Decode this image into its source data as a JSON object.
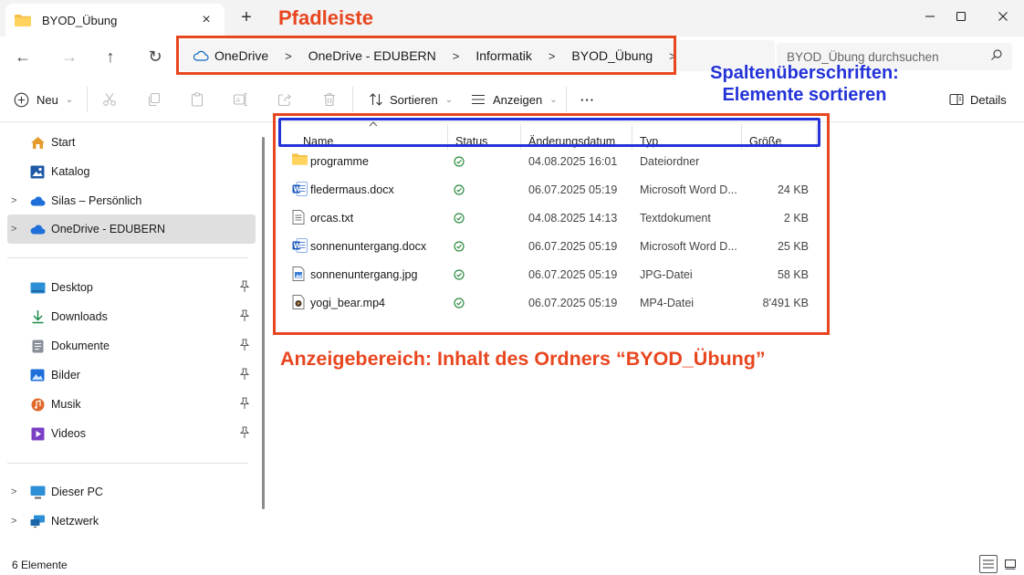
{
  "window": {
    "tab_title": "BYOD_Übung",
    "close_tab": "×",
    "new_tab": "+",
    "minimize": "—",
    "maximize": "☐",
    "close": "✕"
  },
  "nav": {
    "back": "←",
    "forward": "→",
    "up": "↑",
    "refresh": "↻"
  },
  "breadcrumb": {
    "items": [
      "OneDrive",
      "OneDrive - EDUBERN",
      "Informatik",
      "BYOD_Übung"
    ],
    "separator": ">",
    "trailing": ">"
  },
  "search": {
    "placeholder": "BYOD_Übung durchsuchen"
  },
  "toolbar": {
    "new_label": "Neu",
    "sort_label": "Sortieren",
    "view_label": "Anzeigen",
    "more_label": "···",
    "details_label": "Details"
  },
  "sidebar": {
    "top": [
      {
        "label": "Start",
        "icon": "home-icon"
      },
      {
        "label": "Katalog",
        "icon": "gallery-icon"
      },
      {
        "label": "Silas – Persönlich",
        "icon": "cloud-icon",
        "expandable": true
      },
      {
        "label": "OneDrive - EDUBERN",
        "icon": "cloud-icon",
        "expandable": true,
        "selected": true
      }
    ],
    "quick": [
      {
        "label": "Desktop",
        "icon": "desktop-icon"
      },
      {
        "label": "Downloads",
        "icon": "download-icon"
      },
      {
        "label": "Dokumente",
        "icon": "documents-icon"
      },
      {
        "label": "Bilder",
        "icon": "pictures-icon"
      },
      {
        "label": "Musik",
        "icon": "music-icon"
      },
      {
        "label": "Videos",
        "icon": "videos-icon"
      }
    ],
    "bottom": [
      {
        "label": "Dieser PC",
        "icon": "pc-icon"
      },
      {
        "label": "Netzwerk",
        "icon": "network-icon"
      }
    ]
  },
  "columns": {
    "name": "Name",
    "status": "Status",
    "date": "Änderungsdatum",
    "type": "Typ",
    "size": "Größe"
  },
  "files": [
    {
      "name": "programme",
      "date": "04.08.2025 16:01",
      "type": "Dateiordner",
      "size": "",
      "icon": "folder-icon"
    },
    {
      "name": "fledermaus.docx",
      "date": "06.07.2025 05:19",
      "type": "Microsoft Word D...",
      "size": "24 KB",
      "icon": "word-icon"
    },
    {
      "name": "orcas.txt",
      "date": "04.08.2025 14:13",
      "type": "Textdokument",
      "size": "2 KB",
      "icon": "text-file-icon"
    },
    {
      "name": "sonnenuntergang.docx",
      "date": "06.07.2025 05:19",
      "type": "Microsoft Word D...",
      "size": "25 KB",
      "icon": "word-icon"
    },
    {
      "name": "sonnenuntergang.jpg",
      "date": "06.07.2025 05:19",
      "type": "JPG-Datei",
      "size": "58 KB",
      "icon": "image-file-icon"
    },
    {
      "name": "yogi_bear.mp4",
      "date": "06.07.2025 05:19",
      "type": "MP4-Datei",
      "size": "8'491 KB",
      "icon": "video-file-icon"
    }
  ],
  "status": {
    "count": "6 Elemente"
  },
  "annotations": {
    "path_bar": "Pfadleiste",
    "headers_line1": "Spaltenüberschriften:",
    "headers_line2": "Elemente sortieren",
    "content_area": "Anzeigebereich: Inhalt des Ordners “BYOD_Übung”",
    "red": "#e8461f",
    "blue": "#2333d8"
  }
}
